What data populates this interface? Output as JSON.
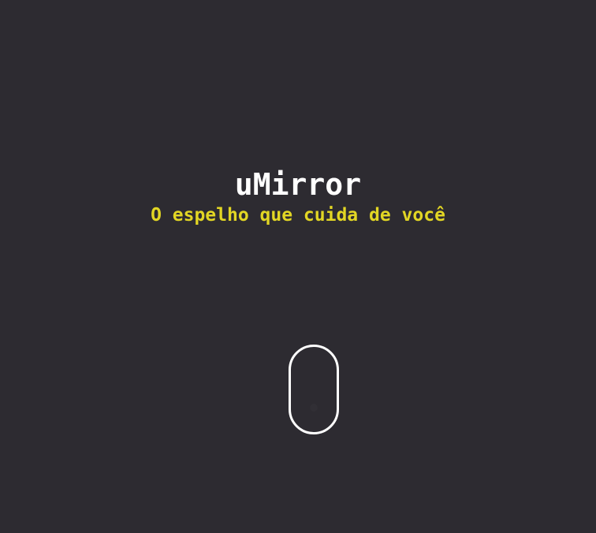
{
  "hero": {
    "title": "uMirror",
    "subtitle": "O espelho que cuida de você"
  },
  "colors": {
    "background": "#2d2b31",
    "title": "#ffffff",
    "subtitle": "#e2d624",
    "indicator_border": "#ffffff"
  },
  "icons": {
    "scroll_indicator": "mouse-scroll-icon"
  }
}
